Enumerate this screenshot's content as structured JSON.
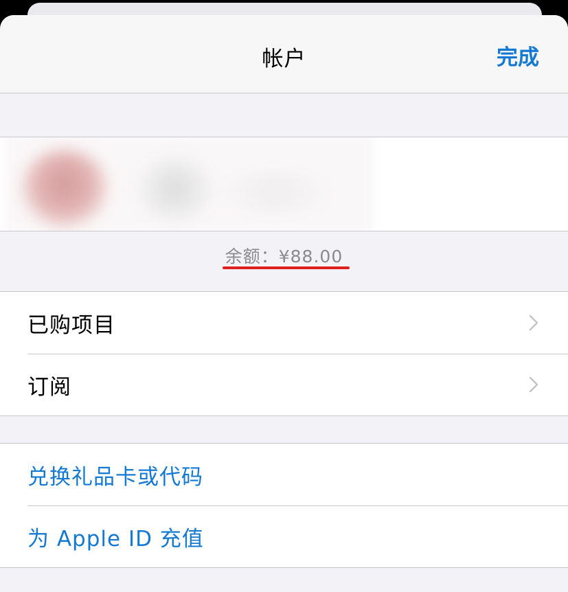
{
  "navbar": {
    "title": "帐户",
    "done_label": "完成"
  },
  "account": {
    "balance": "余额：¥88.00"
  },
  "menu_group": [
    {
      "label": "已购项目",
      "icon": "chevron-right-icon"
    },
    {
      "label": "订阅",
      "icon": "chevron-right-icon"
    }
  ],
  "action_group": [
    {
      "label": "兑换礼品卡或代码"
    },
    {
      "label": "为 Apple ID 充值"
    }
  ],
  "colors": {
    "accent": "#1479d3",
    "highlight_underline": "#e0201e",
    "background": "#f2f2f7",
    "separator": "#c8c7cc"
  }
}
